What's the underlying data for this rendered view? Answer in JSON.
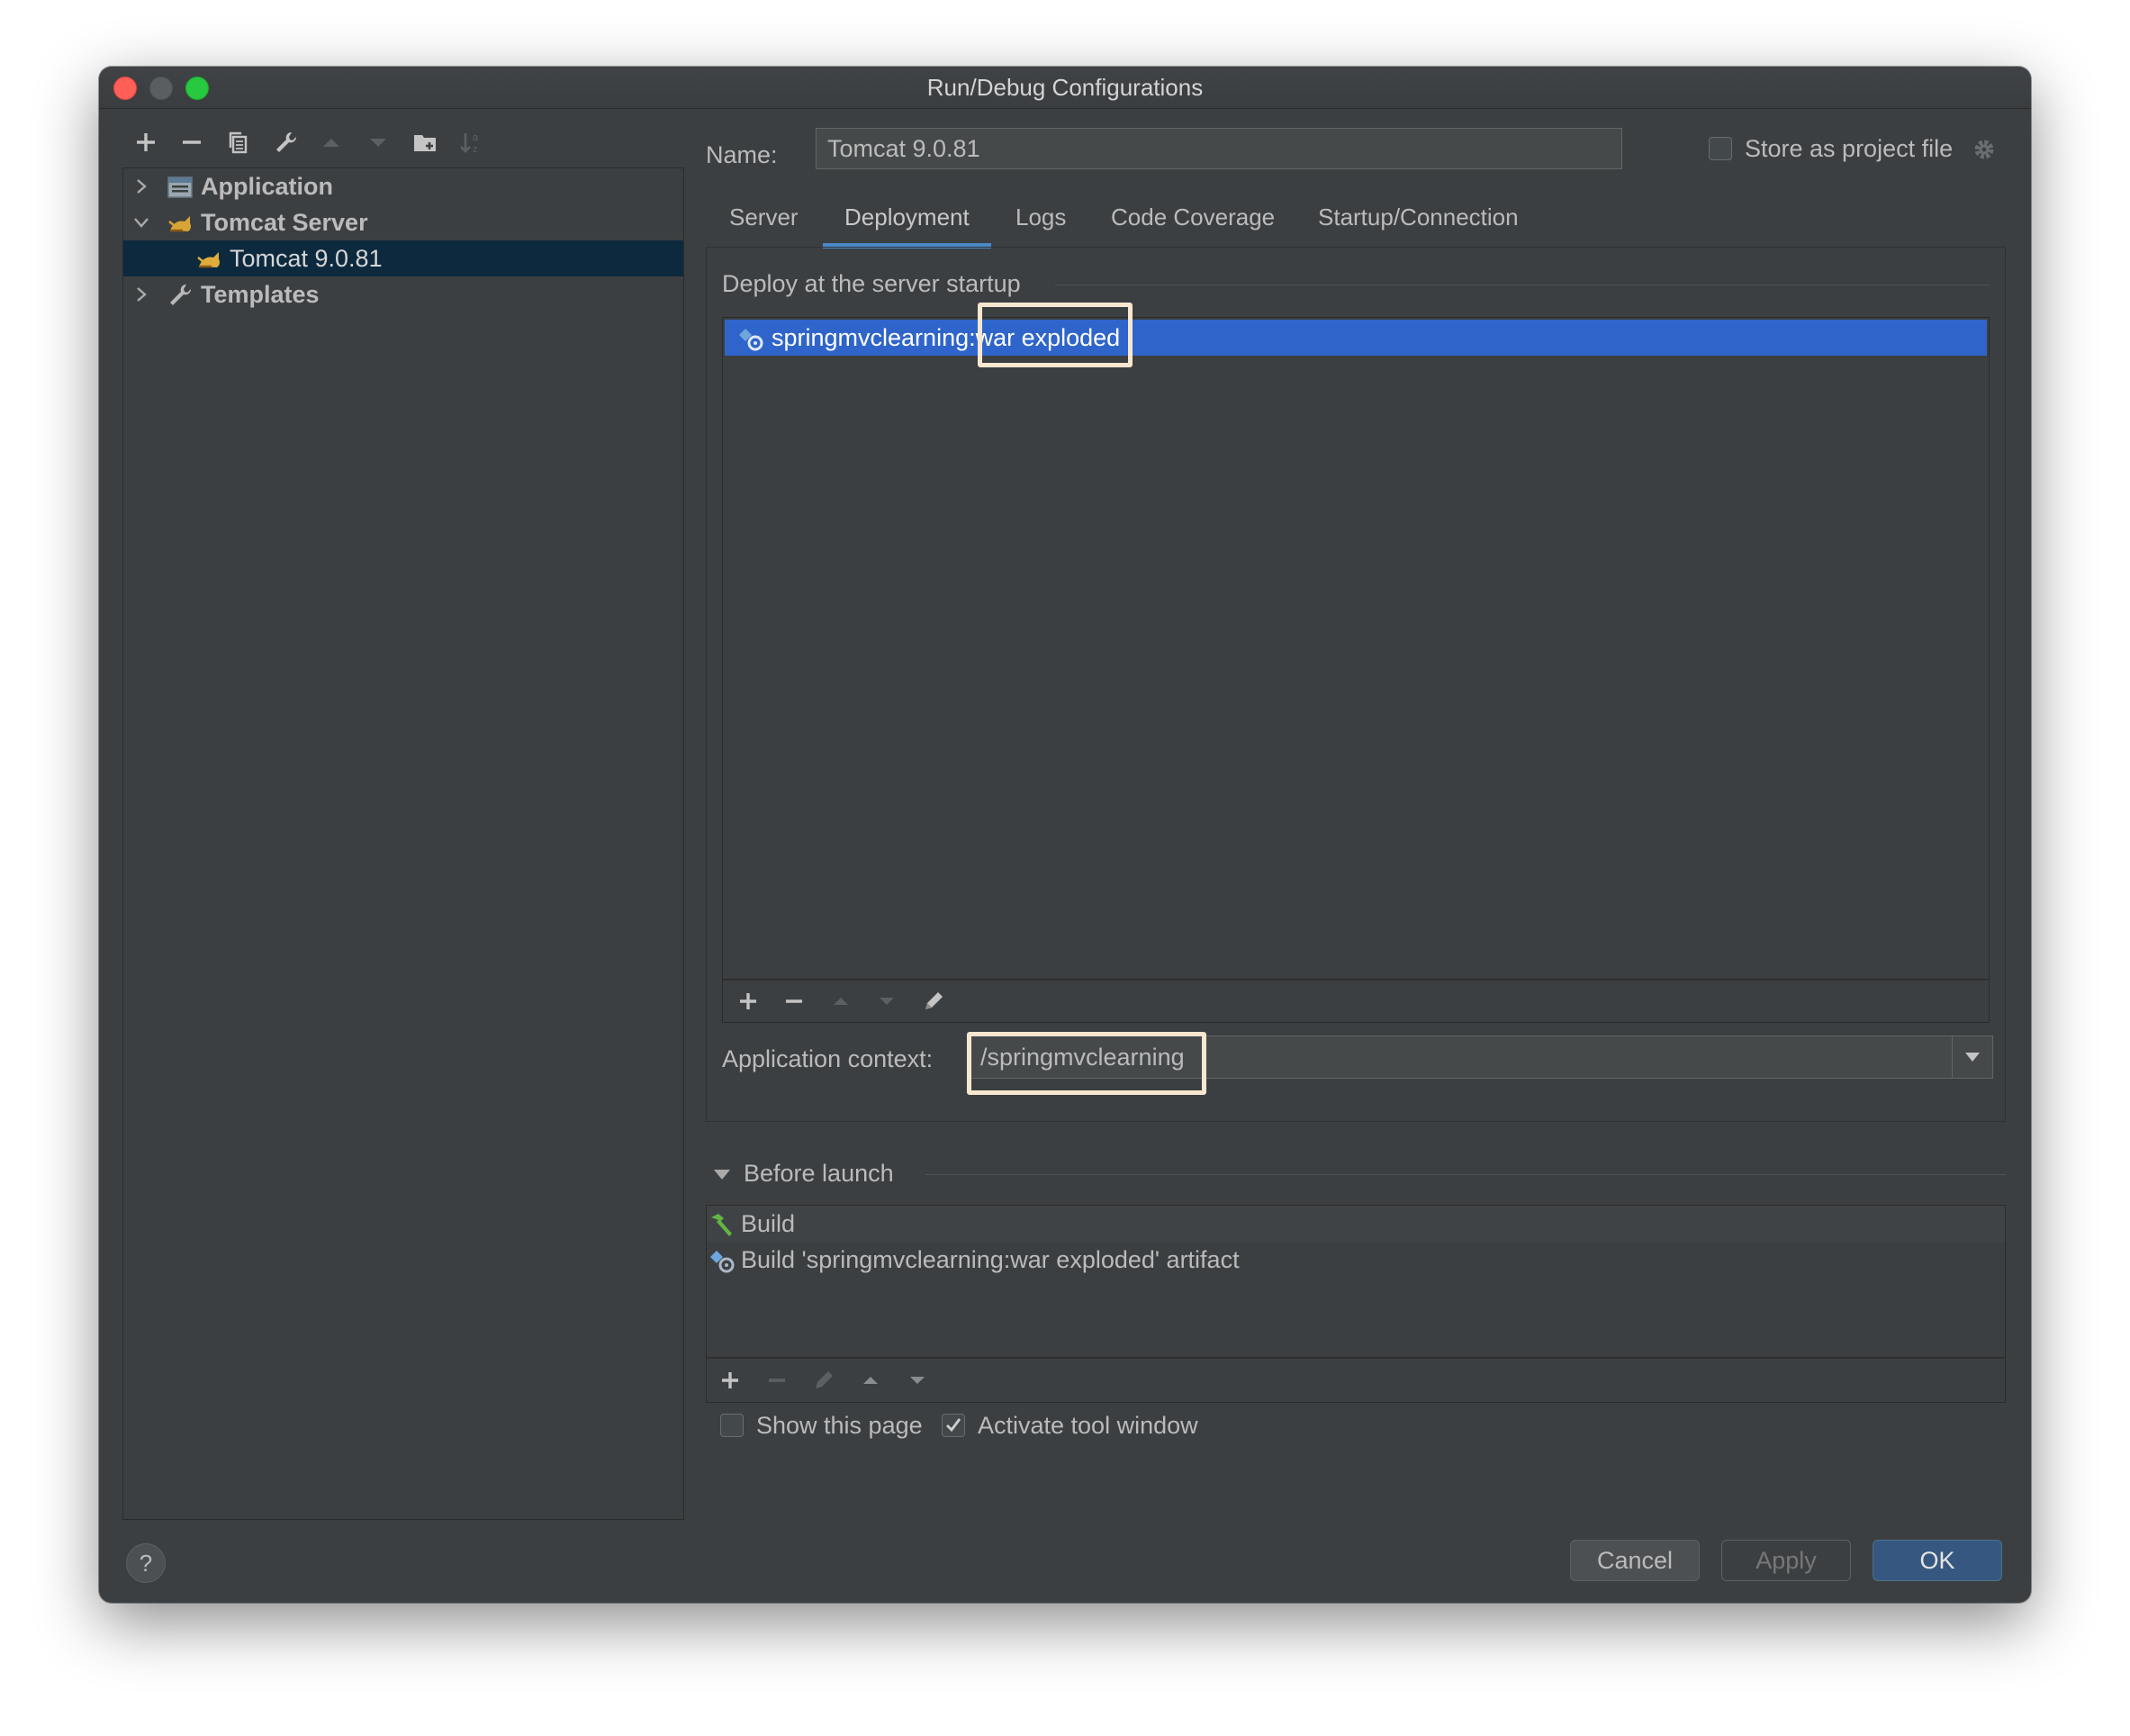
{
  "window": {
    "title": "Run/Debug Configurations"
  },
  "tree": {
    "items": [
      {
        "label": "Application",
        "icon": "application-icon",
        "expanded": false
      },
      {
        "label": "Tomcat Server",
        "icon": "tomcat-icon",
        "expanded": true
      },
      {
        "label": "Tomcat 9.0.81",
        "icon": "tomcat-icon",
        "selected": true
      },
      {
        "label": "Templates",
        "icon": "wrench-icon",
        "expanded": false
      }
    ]
  },
  "config": {
    "name_label": "Name:",
    "name_value": "Tomcat 9.0.81",
    "store_label": "Store as project file",
    "store_checked": false
  },
  "tabs": [
    "Server",
    "Deployment",
    "Logs",
    "Code Coverage",
    "Startup/Connection"
  ],
  "active_tab": "Deployment",
  "deployment": {
    "section_title": "Deploy at the server startup",
    "items": [
      "springmvclearning:war exploded"
    ],
    "context_label": "Application context:",
    "context_value": "/springmvclearning"
  },
  "before_launch": {
    "title": "Before launch",
    "items": [
      {
        "label": "Build",
        "icon": "hammer-icon"
      },
      {
        "label": "Build 'springmvclearning:war exploded' artifact",
        "icon": "artifact-icon"
      }
    ],
    "show_page_label": "Show this page",
    "show_page_checked": false,
    "activate_label": "Activate tool window",
    "activate_checked": true
  },
  "buttons": {
    "cancel": "Cancel",
    "apply": "Apply",
    "ok": "OK",
    "help": "?"
  },
  "colors": {
    "background": "#3c3f41",
    "selection": "#0d293e",
    "list_selection": "#2f65ca",
    "accent": "#4a88c7",
    "highlight_box": "#f7e7d0"
  }
}
